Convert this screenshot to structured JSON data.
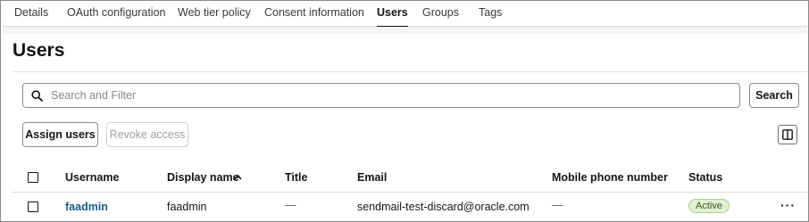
{
  "tabs": [
    {
      "label": "Details"
    },
    {
      "label": "OAuth configuration"
    },
    {
      "label": "Web tier policy"
    },
    {
      "label": "Consent information"
    },
    {
      "label": "Users"
    },
    {
      "label": "Groups"
    },
    {
      "label": "Tags"
    }
  ],
  "active_tab": "Users",
  "page": {
    "title": "Users"
  },
  "search": {
    "placeholder": "Search and Filter",
    "value": "",
    "button_label": "Search"
  },
  "actions": {
    "assign_label": "Assign users",
    "revoke_label": "Revoke access"
  },
  "table": {
    "columns": [
      "Username",
      "Display name",
      "Title",
      "Email",
      "Mobile phone number",
      "Status"
    ],
    "sorted_column": "Display name",
    "sort_direction": "ascending",
    "rows": [
      {
        "username": "faadmin",
        "display_name": "faadmin",
        "title": "—",
        "email": "sendmail-test-discard@oracle.com",
        "mobile": "—",
        "status": "Active",
        "actions": "···"
      }
    ]
  },
  "colors": {
    "link": "#1a5c83",
    "active_badge_bg": "#e1f0d3",
    "active_badge_text": "#3b5a20"
  },
  "icons": [
    "search-icon",
    "sort-ascending-icon",
    "columns-icon",
    "more-actions-icon"
  ]
}
